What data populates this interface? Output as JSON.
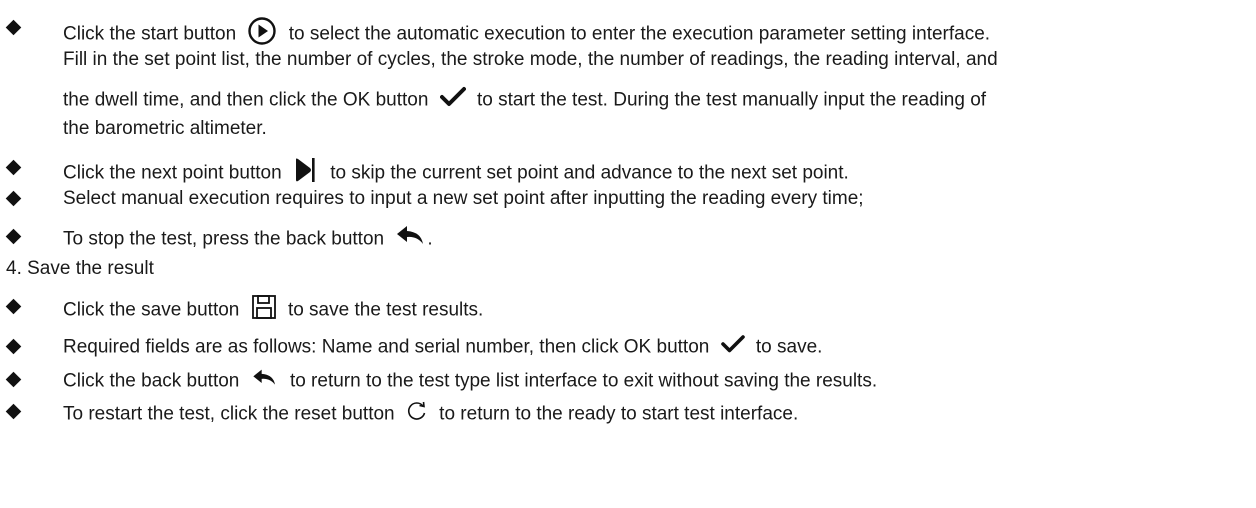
{
  "icons": {
    "start": "play-circle-icon",
    "ok": "checkmark-icon",
    "next_point": "skip-next-icon",
    "back": "back-arrow-icon",
    "save": "floppy-disk-icon",
    "reset": "reset-circular-arrow-icon"
  },
  "execution": {
    "item1": {
      "line1_before": "Click the start button",
      "line1_after": "to select the automatic execution to enter the execution parameter setting interface.",
      "line2": "Fill in the set point list, the number of cycles, the stroke mode, the number of readings, the reading interval, and",
      "line3_before": "the dwell time, and then click the OK button",
      "line3_after": "to start the test. During the test manually input the reading of",
      "line4": "the barometric altimeter."
    },
    "item2": {
      "before": "Click the next point button",
      "after": "to skip the current set point and advance to the next set point."
    },
    "item3": "Select manual execution requires to input a new set point after inputting the reading every time;",
    "item4": {
      "before": "To stop the test, press the back button",
      "after": "."
    }
  },
  "save_section": {
    "heading": "4. Save the result",
    "item1": {
      "before": "Click the save button",
      "after": "to save the test results."
    },
    "item2": {
      "before": "Required fields are as follows: Name and serial number, then click OK button",
      "after": "to save."
    },
    "item3": {
      "before": "Click the back button",
      "after": "to return to the test type list interface to exit without saving the results."
    },
    "item4": {
      "before": "To restart the test, click the reset button",
      "after": "to return to the ready to start test interface."
    }
  }
}
